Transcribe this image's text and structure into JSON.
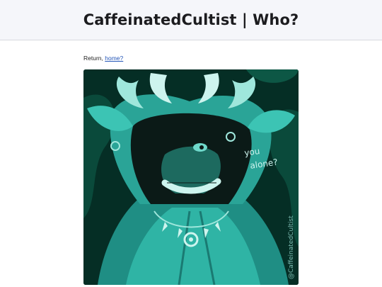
{
  "header": {
    "title": "CaffeinatedCultist | Who?"
  },
  "nav": {
    "return_prefix": "Return,",
    "home_link": "home?"
  },
  "artwork": {
    "caption_line1": "you",
    "caption_line2": "alone?",
    "signature": "@CaffeinatedCultist",
    "colors": {
      "background": "#063b2e",
      "teal": "#2fb4a5",
      "teal_light": "#6fd9cb",
      "dark": "#0b1a17",
      "horn": "#9fe7dc"
    }
  }
}
